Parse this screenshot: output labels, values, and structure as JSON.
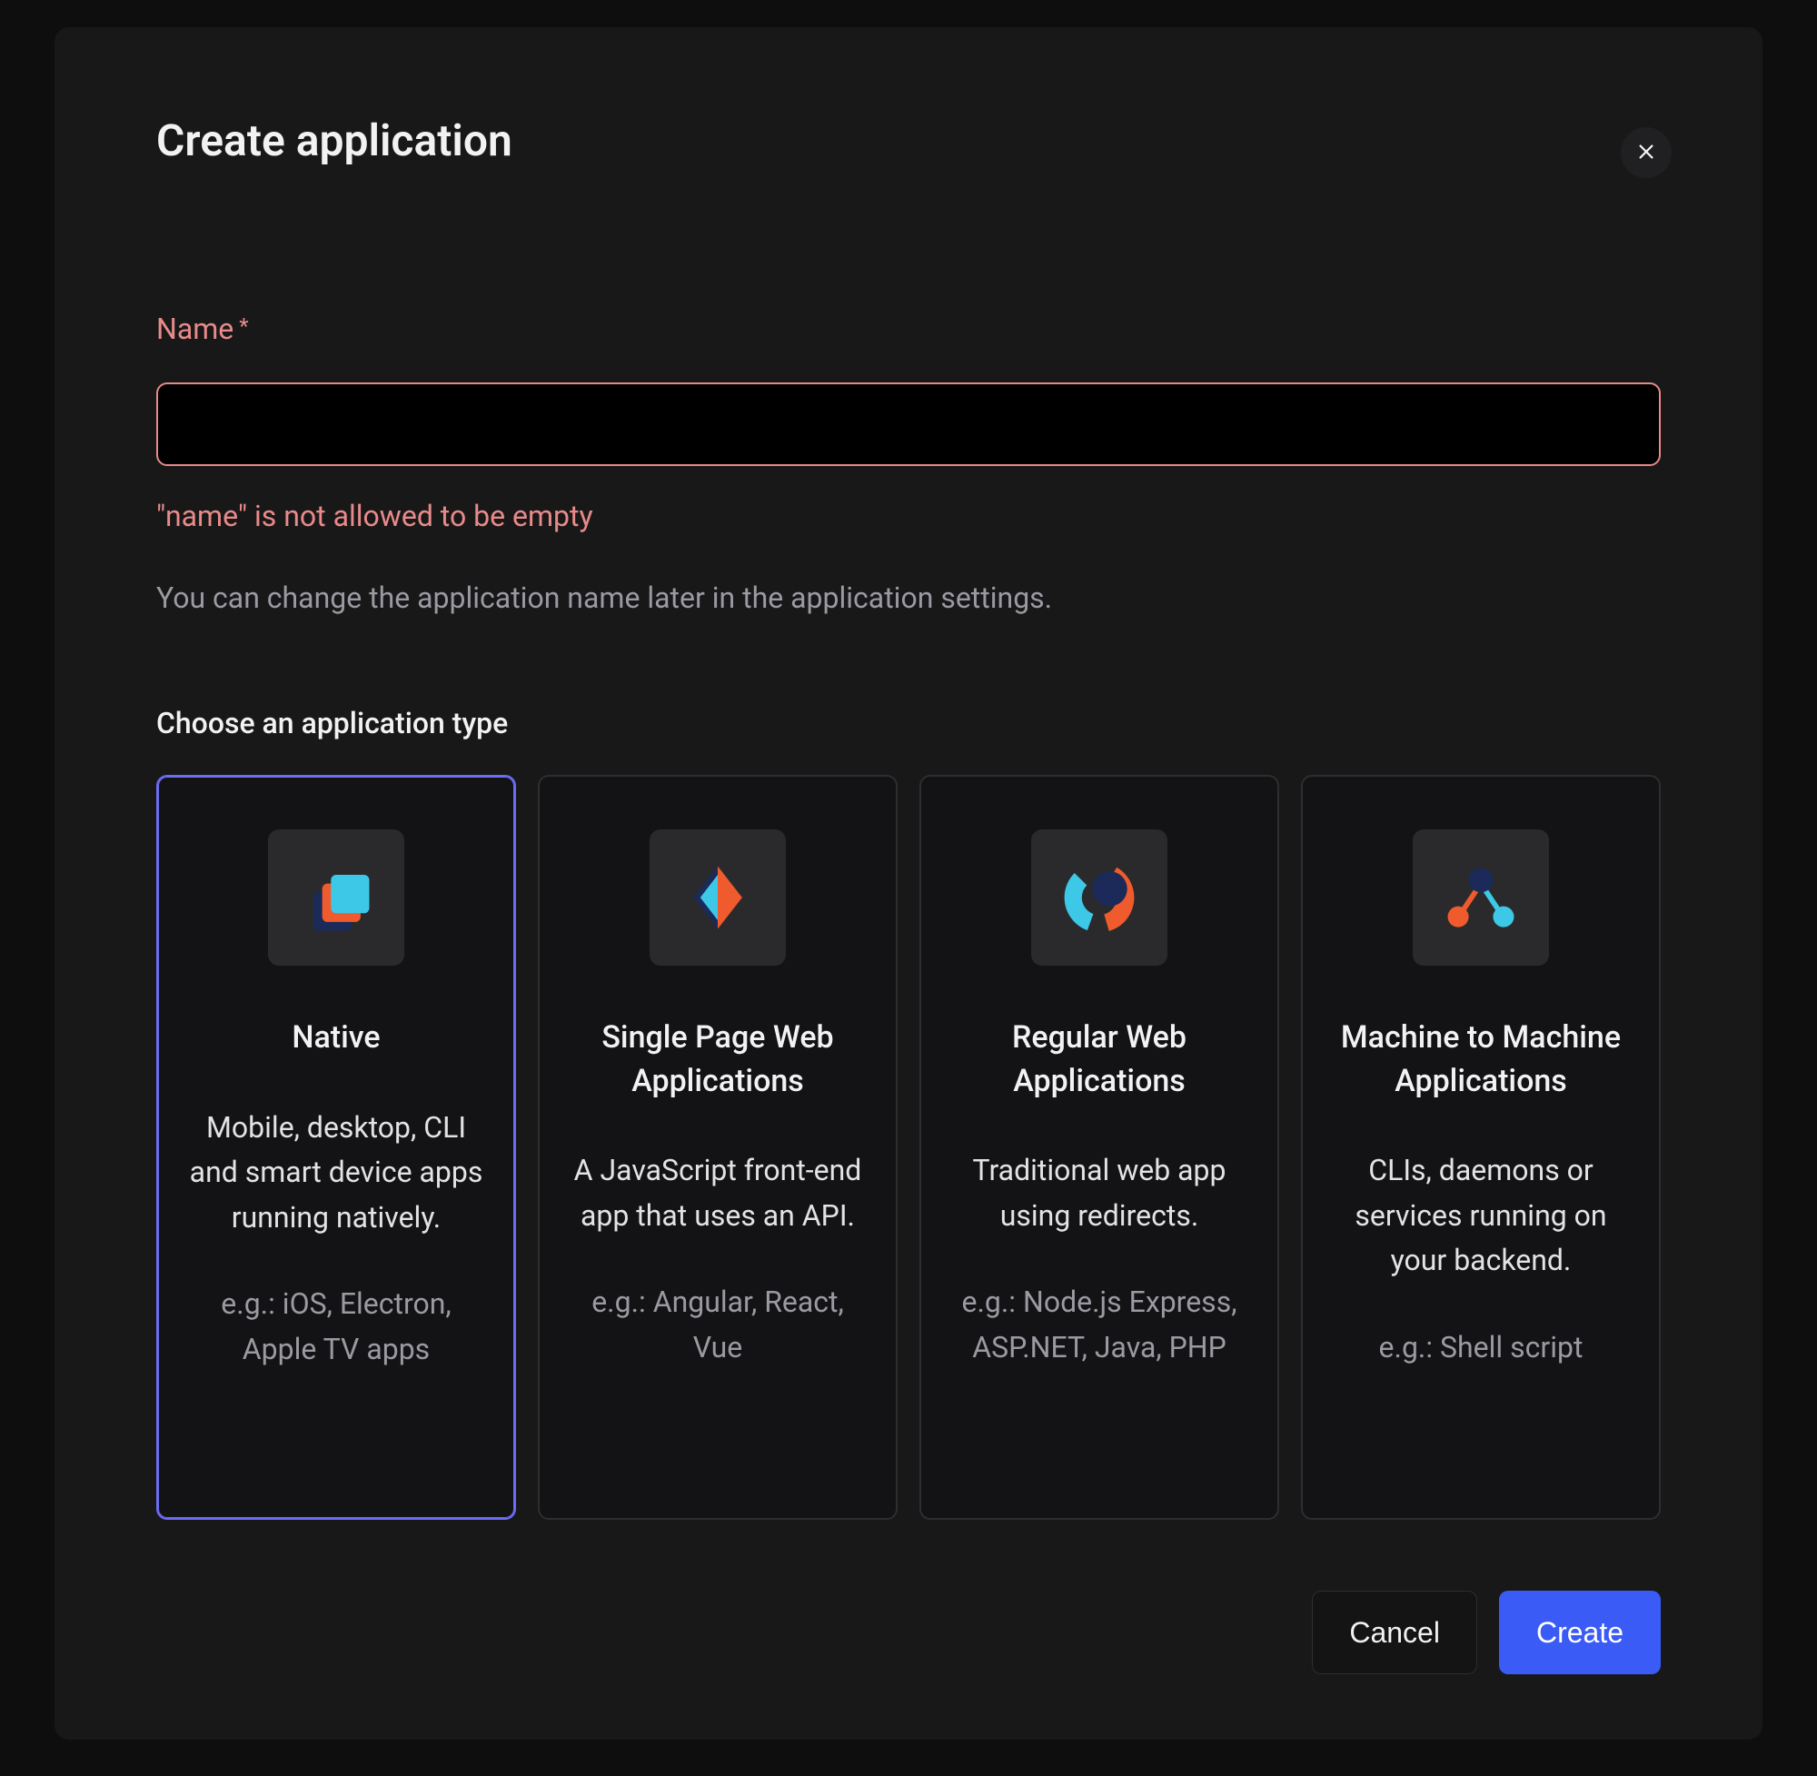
{
  "colors": {
    "error": "#e98a8a",
    "selected": "#6c6cf5",
    "primary": "#3b5bf6",
    "icon_cyan": "#3cc8e6",
    "icon_orange": "#ef5b2c",
    "icon_navy": "#1b2a58"
  },
  "dialog": {
    "title": "Create application",
    "name_field": {
      "label": "Name",
      "required_glyph": "*",
      "value": "",
      "error": "\"name\" is not allowed to be empty",
      "help": "You can change the application name later in the application settings."
    },
    "type_section": {
      "heading": "Choose an application type",
      "selected_index": 0,
      "options": [
        {
          "id": "native",
          "icon": "native-icon",
          "title": "Native",
          "description": "Mobile, desktop, CLI and smart device apps running natively.",
          "examples": "e.g.: iOS, Electron, Apple TV apps"
        },
        {
          "id": "spa",
          "icon": "spa-icon",
          "title": "Single Page Web Applications",
          "description": "A JavaScript front-end app that uses an API.",
          "examples": "e.g.: Angular, React, Vue"
        },
        {
          "id": "regular",
          "icon": "regular-web-icon",
          "title": "Regular Web Applications",
          "description": "Traditional web app using redirects.",
          "examples": "e.g.: Node.js Express, ASP.NET, Java, PHP"
        },
        {
          "id": "m2m",
          "icon": "m2m-icon",
          "title": "Machine to Machine Applications",
          "description": "CLIs, daemons or services running on your backend.",
          "examples": "e.g.: Shell script"
        }
      ]
    },
    "buttons": {
      "cancel": "Cancel",
      "create": "Create"
    }
  }
}
